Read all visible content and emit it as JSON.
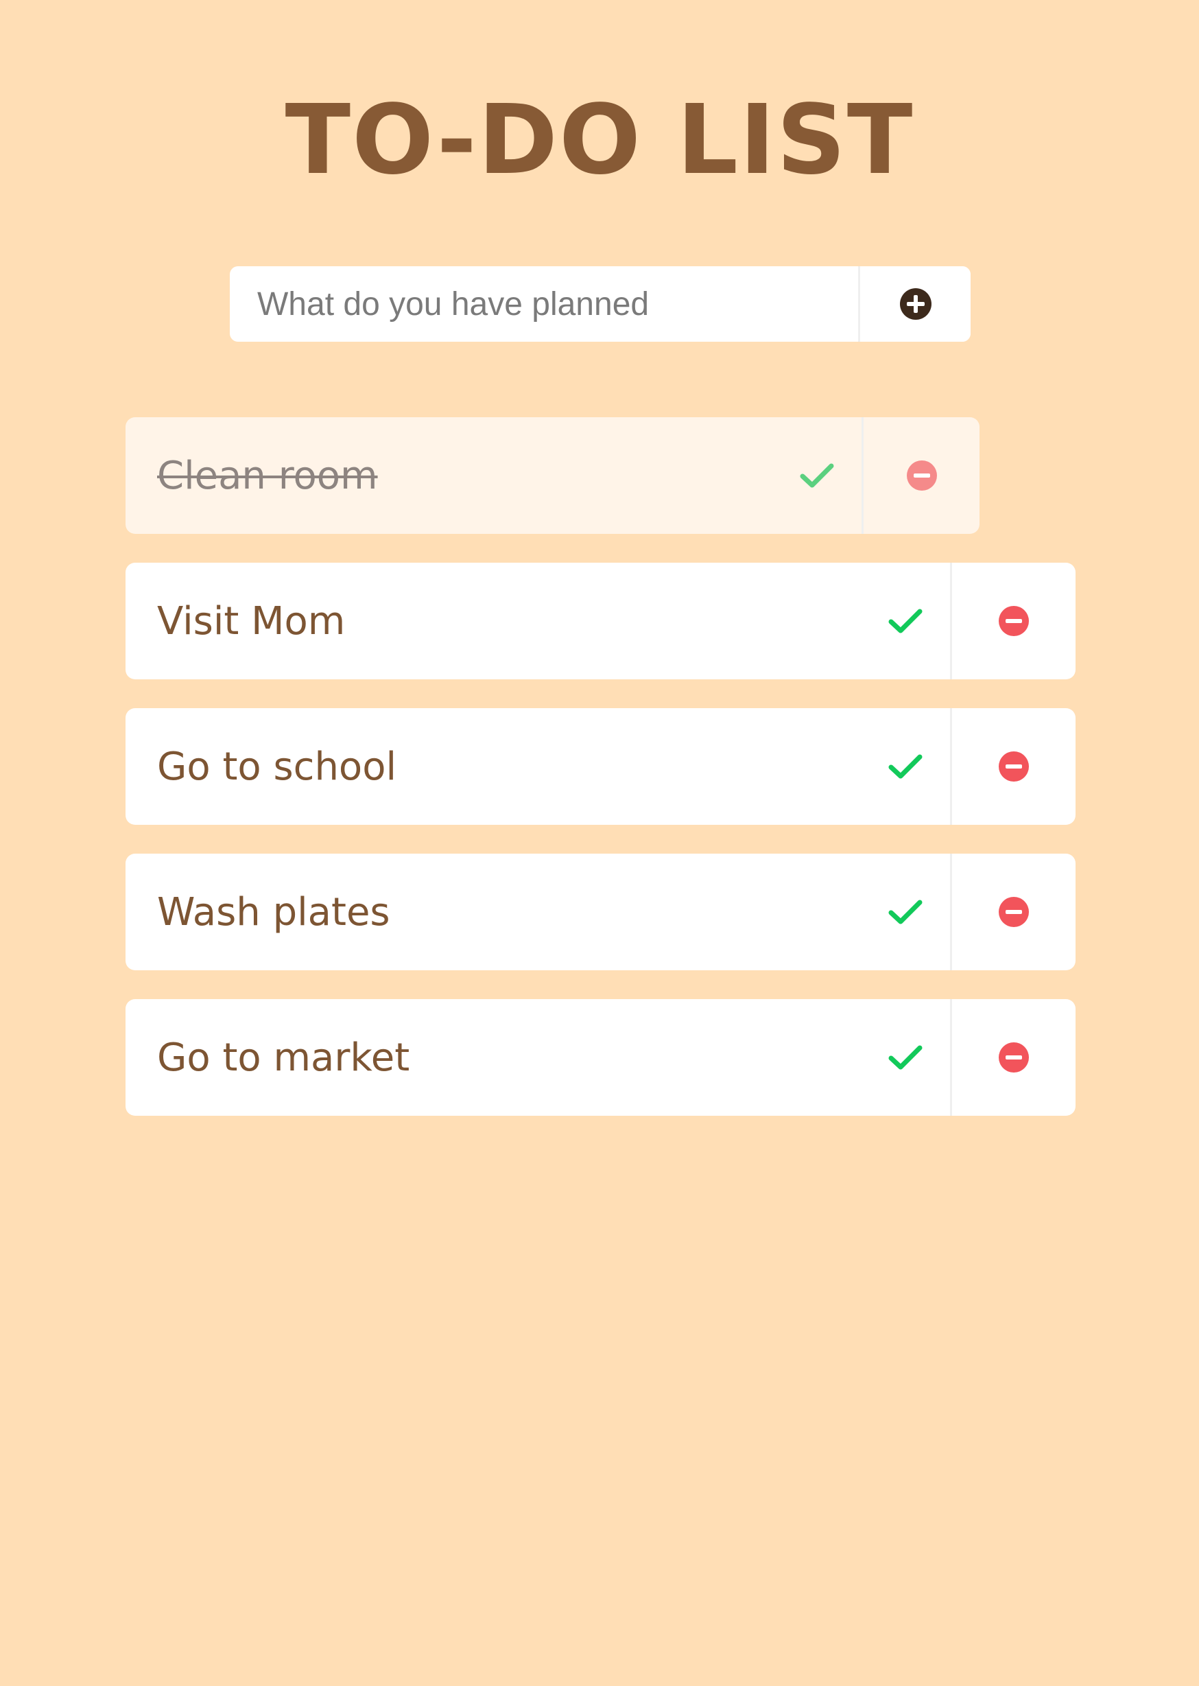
{
  "header": {
    "title": "TO-DO LIST"
  },
  "add_form": {
    "placeholder": "What do you have planned",
    "value": ""
  },
  "todos": [
    {
      "text": "Clean room",
      "completed": true
    },
    {
      "text": "Visit Mom",
      "completed": false
    },
    {
      "text": "Go to school",
      "completed": false
    },
    {
      "text": "Wash plates",
      "completed": false
    },
    {
      "text": "Go to market",
      "completed": false
    }
  ],
  "icons": {
    "add": "plus-circle-icon",
    "check": "check-icon",
    "delete": "minus-circle-icon"
  },
  "colors": {
    "background": "#FFDEB5",
    "title": "#875A35",
    "check": "#12C95A",
    "delete": "#F2545B"
  }
}
